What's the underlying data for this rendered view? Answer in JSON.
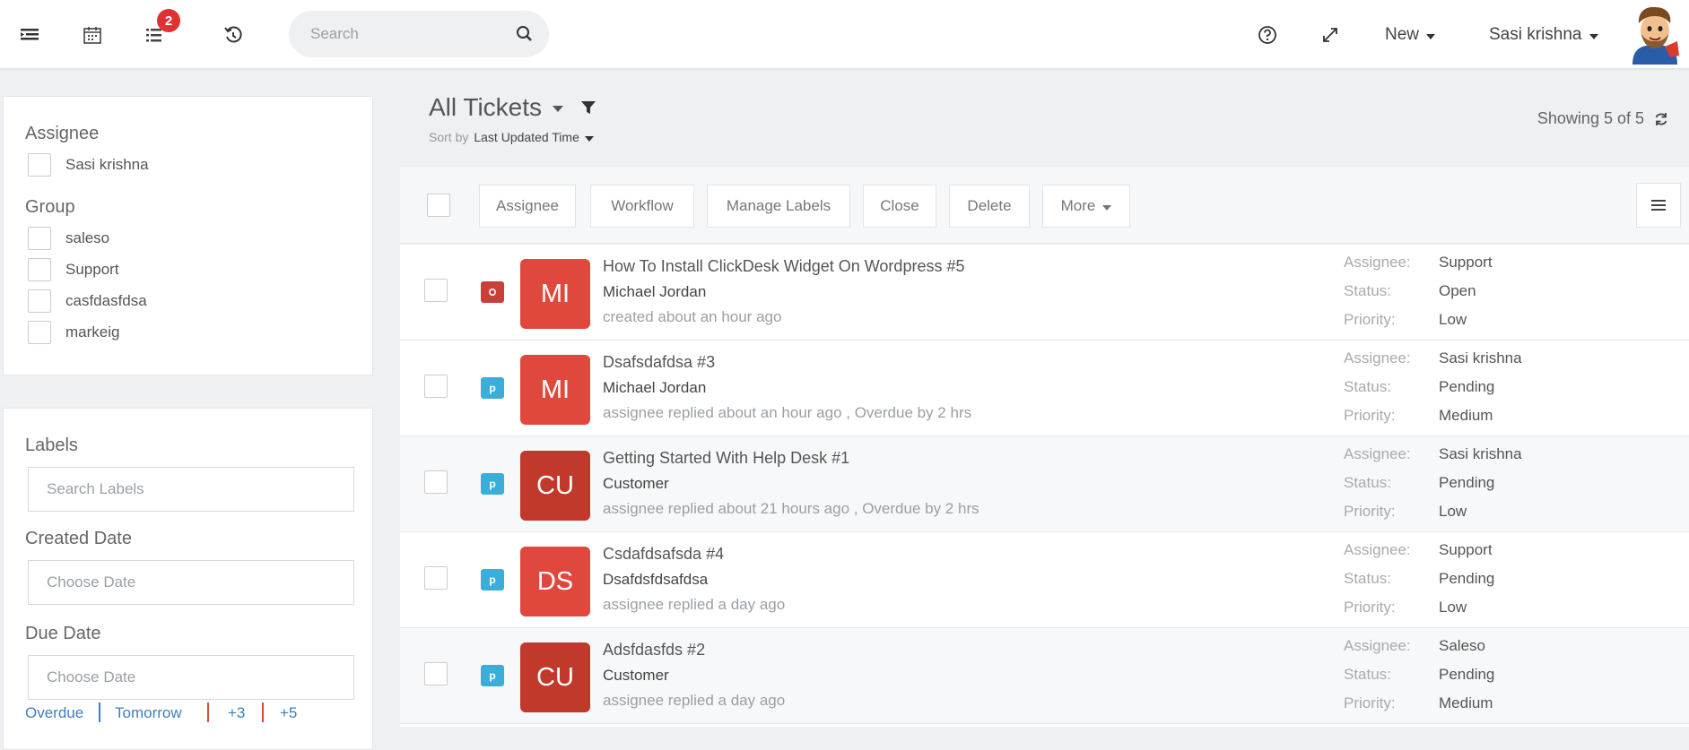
{
  "topbar": {
    "notification_count": "2",
    "search_placeholder": "Search",
    "new_label": "New",
    "user_name": "Sasi krishna"
  },
  "filters": {
    "assignee_title": "Assignee",
    "assignees": [
      "Sasi krishna"
    ],
    "group_title": "Group",
    "groups": [
      "saleso",
      "Support",
      "casfdasfdsa",
      "markeig"
    ],
    "labels_title": "Labels",
    "labels_placeholder": "Search Labels",
    "created_title": "Created Date",
    "created_placeholder": "Choose Date",
    "due_title": "Due Date",
    "due_placeholder": "Choose Date",
    "due_quick": [
      "Overdue",
      "Tomorrow",
      "+3",
      "+5"
    ]
  },
  "header": {
    "title": "All Tickets",
    "sort_prefix": "Sort by",
    "sort_value": "Last Updated Time",
    "showing": "Showing 5 of 5"
  },
  "toolbar": {
    "assignee": "Assignee",
    "workflow": "Workflow",
    "manage_labels": "Manage Labels",
    "close": "Close",
    "delete": "Delete",
    "more": "More"
  },
  "meta_labels": {
    "assignee": "Assignee:",
    "status": "Status:",
    "priority": "Priority:"
  },
  "tickets": [
    {
      "type": "o",
      "type_color": "#c9403a",
      "initials": "MI",
      "initials_color": "#e0483d",
      "subject": "How To Install ClickDesk Widget On Wordpress #5",
      "requester": "Michael Jordan",
      "activity": "created about an hour ago",
      "assignee": "Support",
      "status": "Open",
      "priority": "Low"
    },
    {
      "type": "p",
      "type_color": "#3aaed8",
      "initials": "MI",
      "initials_color": "#e0483d",
      "subject": "Dsafsdafdsa #3",
      "requester": "Michael Jordan",
      "activity": "assignee replied about an hour ago , Overdue by 2 hrs",
      "assignee": "Sasi krishna",
      "status": "Pending",
      "priority": "Medium"
    },
    {
      "type": "p",
      "type_color": "#3aaed8",
      "initials": "CU",
      "initials_color": "#c0392b",
      "subject": "Getting Started With Help Desk #1",
      "requester": "Customer",
      "activity": "assignee replied about 21 hours ago , Overdue by 2 hrs",
      "assignee": "Sasi krishna",
      "status": "Pending",
      "priority": "Low"
    },
    {
      "type": "p",
      "type_color": "#3aaed8",
      "initials": "DS",
      "initials_color": "#e0483d",
      "subject": "Csdafdsafsda #4",
      "requester": "Dsafdsfdsafdsa",
      "activity": "assignee replied a day ago",
      "assignee": "Support",
      "status": "Pending",
      "priority": "Low"
    },
    {
      "type": "p",
      "type_color": "#3aaed8",
      "initials": "CU",
      "initials_color": "#c0392b",
      "subject": "Adsfdasfds #2",
      "requester": "Customer",
      "activity": "assignee replied a day ago",
      "assignee": "Saleso",
      "status": "Pending",
      "priority": "Medium"
    }
  ]
}
